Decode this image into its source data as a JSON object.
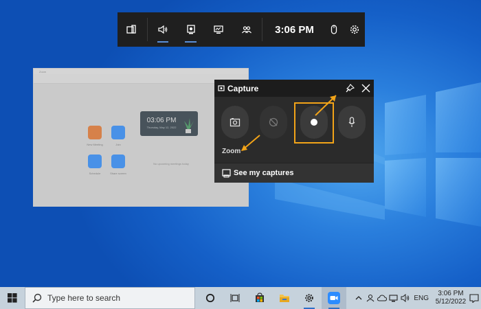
{
  "gamebar": {
    "time": "3:06 PM",
    "buttons": [
      "widget-menu-icon",
      "audio-icon",
      "capture-icon",
      "performance-icon",
      "social-icon",
      "mouse-icon",
      "settings-icon"
    ]
  },
  "zoom_app": {
    "title": "Zoom",
    "clock": "03:06 PM",
    "date": "Thursday, May 12, 2022",
    "tiles": [
      {
        "label": "New Meeting",
        "color": "#e8772e"
      },
      {
        "label": "Join",
        "color": "#2d8cff"
      },
      {
        "label": "Schedule",
        "color": "#2d8cff"
      },
      {
        "label": "Share screen",
        "color": "#2d8cff"
      }
    ],
    "no_meetings": "No upcoming meetings today"
  },
  "capture": {
    "title": "Capture",
    "zoom_label": "Zoom",
    "see_captures": "See my captures",
    "accent": "#f3a418"
  },
  "taskbar": {
    "search_placeholder": "Type here to search",
    "lang": "ENG",
    "time": "3:06 PM",
    "date": "5/12/2022"
  }
}
